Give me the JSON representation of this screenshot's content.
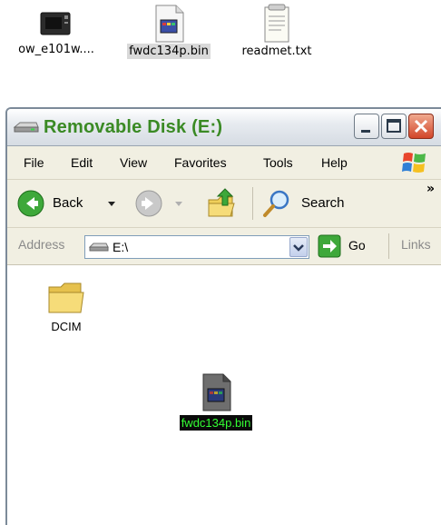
{
  "desktop": {
    "icons": [
      {
        "label": "ow_e101w....",
        "icon": "monitor-icon"
      },
      {
        "label": "fwdc134p.bin",
        "icon": "bin-file-icon"
      },
      {
        "label": "readmet.txt",
        "icon": "text-file-icon"
      }
    ]
  },
  "window": {
    "title": "Removable Disk (E:)",
    "menu": [
      "File",
      "Edit",
      "View",
      "Favorites",
      "Tools",
      "Help"
    ],
    "toolbar": {
      "back_label": "Back",
      "search_label": "Search",
      "overflow": "»"
    },
    "address": {
      "label": "Address",
      "value": "E:\\",
      "go_label": "Go",
      "links_label": "Links"
    },
    "files": [
      {
        "label": "DCIM",
        "icon": "folder-icon"
      },
      {
        "label": "fwdc134p.bin",
        "icon": "bin-file-icon",
        "selected": true
      }
    ]
  },
  "colors": {
    "title_text": "#3a8a24",
    "toolbar_bg": "#f1efe2",
    "selection_bg": "#0a0a0a",
    "selection_text": "#33ff33"
  }
}
